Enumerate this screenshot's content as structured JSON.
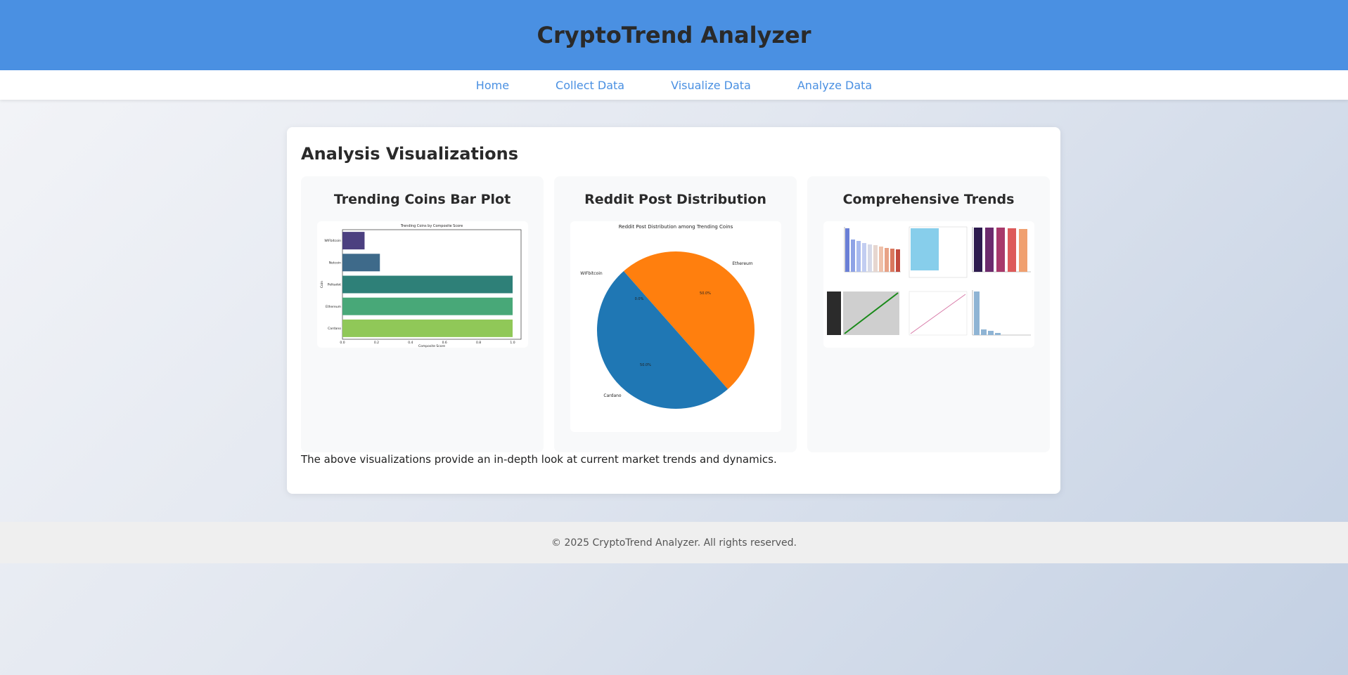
{
  "header": {
    "title": "CryptoTrend Analyzer",
    "bg_color": "#4a90e2"
  },
  "nav": {
    "items": [
      {
        "label": "Home"
      },
      {
        "label": "Collect Data"
      },
      {
        "label": "Visualize Data"
      },
      {
        "label": "Analyze Data"
      }
    ],
    "link_color": "#4a90e2"
  },
  "main": {
    "title": "Analysis Visualizations",
    "cards": [
      {
        "title": "Trending Coins Bar Plot"
      },
      {
        "title": "Reddit Post Distribution"
      },
      {
        "title": "Comprehensive Trends"
      }
    ],
    "description": "The above visualizations provide an in-depth look at current market trends and dynamics."
  },
  "footer": {
    "text": "© 2025 CryptoTrend Analyzer. All rights reserved."
  },
  "chart_data": [
    {
      "type": "bar",
      "orientation": "horizontal",
      "title": "Trending Coins by Composite Score",
      "xlabel": "Composite Score",
      "ylabel": "Coin",
      "categories": [
        "WIFbitcoin",
        "Netcoin",
        "Polkadot",
        "Ethereum",
        "Cardano"
      ],
      "values": [
        0.13,
        0.22,
        1.0,
        1.0,
        1.0
      ],
      "xlim": [
        0.0,
        1.0
      ],
      "xticks": [
        "0.0",
        "0.2",
        "0.4",
        "0.6",
        "0.8",
        "1.0"
      ],
      "colors": [
        "#4c4080",
        "#3e6a8a",
        "#2e8078",
        "#48a878",
        "#90c858"
      ]
    },
    {
      "type": "pie",
      "title": "Reddit Post Distribution among Trending Coins",
      "slices": [
        {
          "label": "Ethereum",
          "value": 50.0,
          "pct_label": "50.0%",
          "color": "#ff7f0e"
        },
        {
          "label": "Cardano",
          "value": 50.0,
          "pct_label": "50.0%",
          "color": "#1f77b4"
        },
        {
          "label": "WIFbitcoin",
          "value": 0.0,
          "pct_label": "0.0%",
          "color": "#2ca02c"
        }
      ]
    }
  ]
}
